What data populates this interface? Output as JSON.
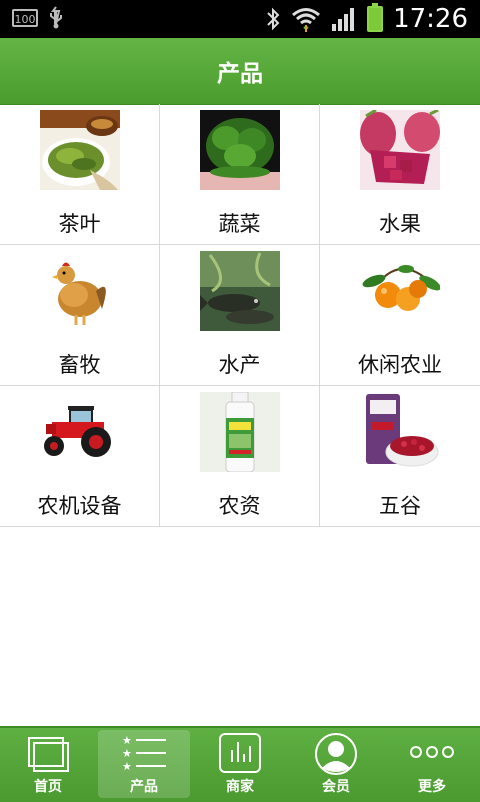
{
  "status_bar": {
    "battery_small_label": "100",
    "time": "17:26",
    "icons": [
      "battery-saver-icon",
      "usb-icon",
      "bluetooth-icon",
      "wifi-icon",
      "signal-icon",
      "battery-icon"
    ]
  },
  "header": {
    "title": "产品"
  },
  "categories": [
    {
      "label": "茶叶",
      "icon": "tea-image"
    },
    {
      "label": "蔬菜",
      "icon": "vegetable-image"
    },
    {
      "label": "水果",
      "icon": "fruit-image"
    },
    {
      "label": "畜牧",
      "icon": "chicken-image"
    },
    {
      "label": "水产",
      "icon": "fish-image"
    },
    {
      "label": "休闲农业",
      "icon": "oranges-image"
    },
    {
      "label": "农机设备",
      "icon": "tractor-image"
    },
    {
      "label": "农资",
      "icon": "fertilizer-bottle-image"
    },
    {
      "label": "五谷",
      "icon": "red-beans-image"
    }
  ],
  "bottom_nav": {
    "items": [
      {
        "label": "首页",
        "icon": "home-icon"
      },
      {
        "label": "产品",
        "icon": "product-list-icon",
        "active": true
      },
      {
        "label": "商家",
        "icon": "merchant-chart-icon"
      },
      {
        "label": "会员",
        "icon": "member-avatar-icon"
      },
      {
        "label": "更多",
        "icon": "more-dots-icon"
      }
    ]
  },
  "colors": {
    "header_green": "#4f9f32",
    "nav_green": "#56a63a",
    "divider": "#d9d9d9"
  }
}
